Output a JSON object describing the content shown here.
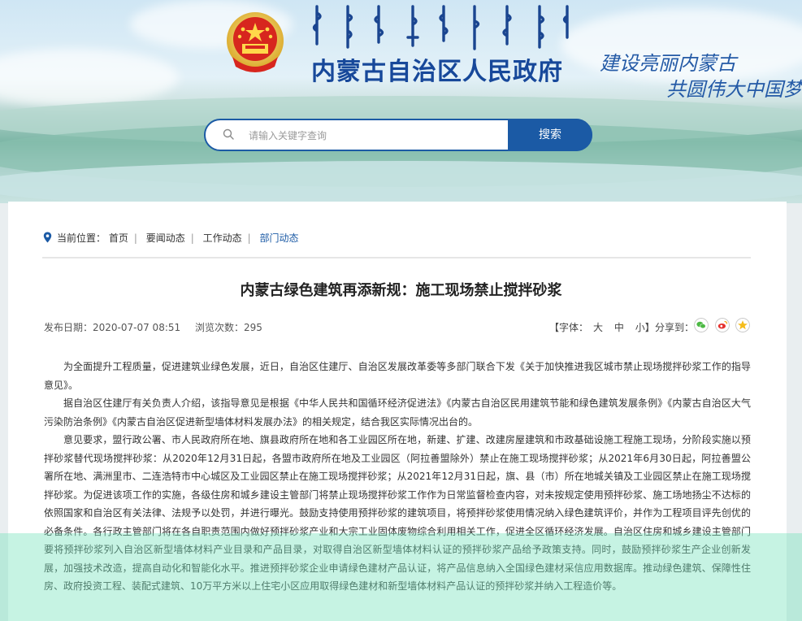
{
  "header": {
    "site_title": "内蒙古自治区人民政府",
    "slogan_line1": "建设亮丽内蒙古",
    "slogan_line2": "共圆伟大中国梦"
  },
  "search": {
    "placeholder": "请输入关键字查询",
    "button_label": "搜索"
  },
  "breadcrumb": {
    "label": "当前位置：",
    "items": [
      "首页",
      "要闻动态",
      "工作动态",
      "部门动态"
    ]
  },
  "article": {
    "title": "内蒙古绿色建筑再添新规：施工现场禁止搅拌砂浆",
    "publish_date": "发布日期：2020-07-07 08:51",
    "views": "浏览次数：295",
    "font_size_label": "【字体：",
    "font_large": "大",
    "font_medium": "中",
    "font_small": "小】",
    "share_label": "分享到：",
    "paragraphs": [
      "为全面提升工程质量，促进建筑业绿色发展，近日，自治区住建厅、自治区发展改革委等多部门联合下发《关于加快推进我区城市禁止现场搅拌砂浆工作的指导意见》。",
      "据自治区住建厅有关负责人介绍，该指导意见是根据《中华人民共和国循环经济促进法》《内蒙古自治区民用建筑节能和绿色建筑发展条例》《内蒙古自治区大气污染防治条例》《内蒙古自治区促进新型墙体材料发展办法》的相关规定，结合我区实际情况出台的。",
      "意见要求，盟行政公署、市人民政府所在地、旗县政府所在地和各工业园区所在地，新建、扩建、改建房屋建筑和市政基础设施工程施工现场，分阶段实施以预拌砂浆替代现场搅拌砂浆：从2020年12月31日起，各盟市政府所在地及工业园区（阿拉善盟除外）禁止在施工现场搅拌砂浆；从2021年6月30日起，阿拉善盟公署所在地、满洲里市、二连浩特市中心城区及工业园区禁止在施工现场搅拌砂浆；从2021年12月31日起，旗、县（市）所在地城关镇及工业园区禁止在施工现场搅拌砂浆。为促进该项工作的实施，各级住房和城乡建设主管部门将禁止现场搅拌砂浆工作作为日常监督检查内容，对未按规定使用预拌砂浆、施工场地扬尘不达标的依照国家和自治区有关法律、法规予以处罚，并进行曝光。鼓励支持使用预拌砂浆的建筑项目，将预拌砂浆使用情况纳入绿色建筑评价，并作为工程项目评先创优的必备条件。各行政主管部门将在各自职责范围内做好预拌砂浆产业和大宗工业固体废物综合利用相关工作，促进全区循环经济发展。自治区住房和城乡建设主管部门要将预拌砂浆列入自治区新型墙体材料产业目录和产品目录，对取得自治区新型墙体材料认证的预拌砂浆产品给予政策支持。同时，鼓励预拌砂浆生产企业创新发展，加强技术改造，提高自动化和智能化水平。推进预拌砂浆企业申请绿色建材产品认证，将产品信息纳入全国绿色建材采信应用数据库。推动绿色建筑、保障性住房、政府投资工程、装配式建筑、10万平方米以上住宅小区应用取得绿色建材和新型墙体材料产品认证的预拌砂浆并纳入工程造价等。"
    ]
  },
  "colors": {
    "brand_blue": "#1b5aa5",
    "title_blue": "#17489a",
    "overlay_tint": "#76e2bc"
  },
  "icons": [
    "government-emblem-icon",
    "search-icon",
    "location-pin-icon",
    "wechat-icon",
    "weibo-icon",
    "qzone-icon"
  ]
}
